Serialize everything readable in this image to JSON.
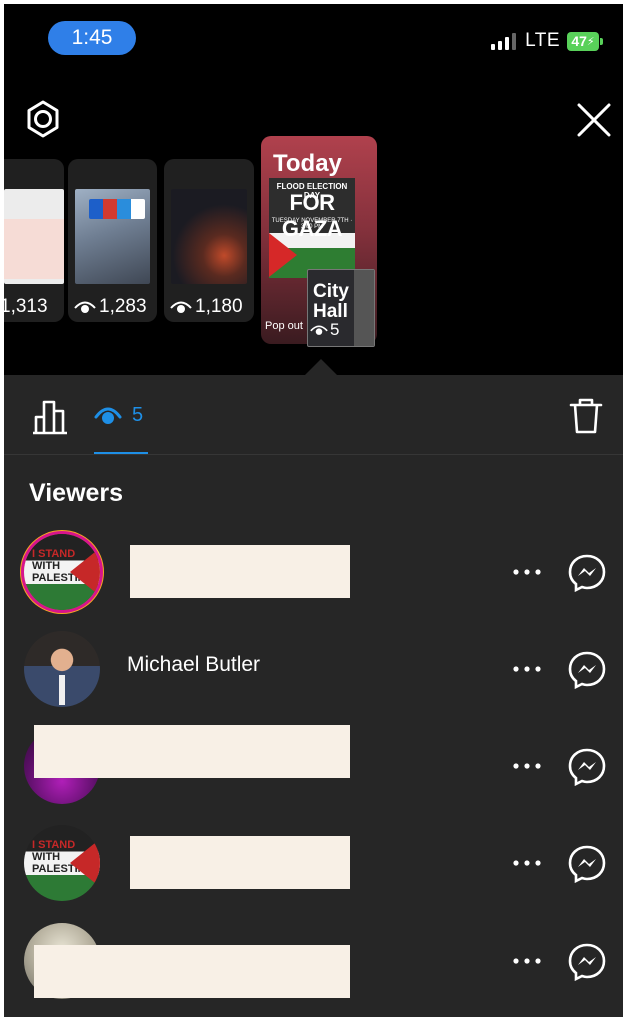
{
  "status_bar": {
    "time": "1:45",
    "network": "LTE",
    "battery": "47"
  },
  "stories": [
    {
      "views": "1,313"
    },
    {
      "views": "1,283"
    },
    {
      "views": "1,180"
    }
  ],
  "current_story": {
    "label": "Today",
    "poster_lines": [
      "FLOOD ELECTION DAY",
      "FOR GAZA",
      "TUESDAY NOVEMBER 7TH · 3:00 PM"
    ],
    "popout_label": "Pop out",
    "city_text": "City Hall",
    "views": "5"
  },
  "tabs": {
    "viewers_count": "5"
  },
  "viewers": {
    "title": "Viewers",
    "list": [
      {
        "name": "",
        "avatar": "palestine-flag"
      },
      {
        "name": "Michael Butler",
        "avatar": "man-suit"
      },
      {
        "name": "",
        "avatar": "pink"
      },
      {
        "name": "",
        "avatar": "palestine-flag"
      },
      {
        "name": "",
        "avatar": "grey"
      }
    ]
  },
  "colors": {
    "accent": "#1e8fe6",
    "panel_bg": "#262626",
    "time_pill": "#2f7fe8",
    "battery": "#59d15a"
  },
  "icons": [
    "gear-icon",
    "close-icon",
    "eye-icon",
    "bar-chart-icon",
    "trash-icon",
    "more-dots-icon",
    "messenger-icon"
  ]
}
